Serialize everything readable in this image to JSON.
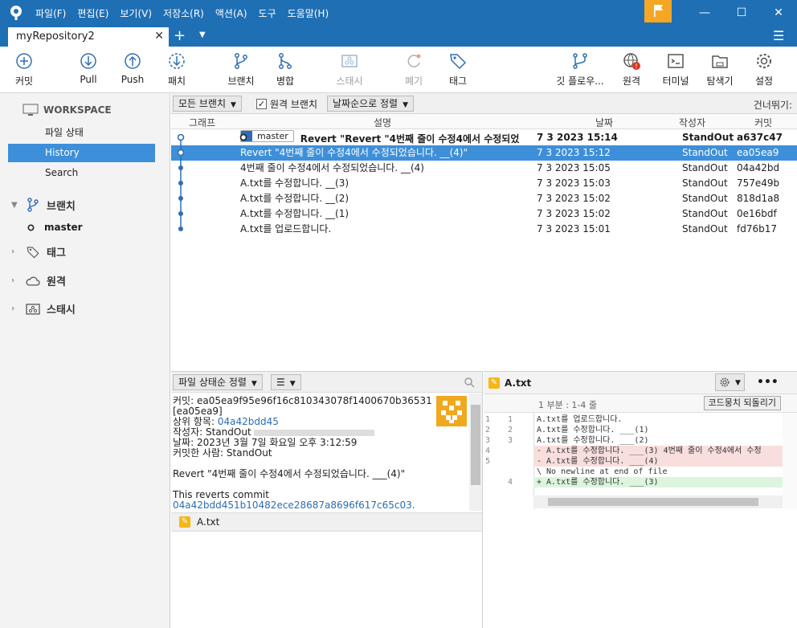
{
  "menu": [
    "파일(F)",
    "편집(E)",
    "보기(V)",
    "저장소(R)",
    "액션(A)",
    "도구",
    "도움말(H)"
  ],
  "window_controls": {
    "minimize": "—",
    "maximize": "☐",
    "close": "✕"
  },
  "tab": {
    "title": "myRepository2",
    "close": "✕",
    "add": "+"
  },
  "toolbar": {
    "commit": "커밋",
    "pull": "Pull",
    "push": "Push",
    "fetch": "패치",
    "branch": "브랜치",
    "merge": "병합",
    "stash": "스태시",
    "discard": "폐기",
    "tag": "태그",
    "gitflow": "깃 플로우...",
    "remote": "원격",
    "terminal": "터미널",
    "explorer": "탐색기",
    "settings": "설정"
  },
  "sidebar": {
    "workspace": "WORKSPACE",
    "items": [
      "파일 상태",
      "History",
      "Search"
    ],
    "branches_label": "브랜치",
    "branch_master": "master",
    "tags_label": "태그",
    "remotes_label": "원격",
    "stash_label": "스태시"
  },
  "filter": {
    "all_branches": "모든 브랜치",
    "remote_branches": "원격 브랜치",
    "sort_by_date": "날짜순으로 정렬",
    "skip": "건너뛰기:"
  },
  "columns": {
    "graph": "그래프",
    "desc": "설명",
    "date": "날짜",
    "author": "작성자",
    "commit": "커밋"
  },
  "commits": [
    {
      "branch": "master",
      "desc": "Revert \"Revert \"4번째 줄이 수정4에서 수정되었",
      "date": "7 3 2023 15:14",
      "author": "StandOut",
      "hash": "a637c47"
    },
    {
      "desc": "Revert \"4번째 줄이 수정4에서 수정되었습니다. __(4)\"",
      "date": "7 3 2023 15:12",
      "author": "StandOut",
      "hash": "ea05ea9"
    },
    {
      "desc": "4번째 줄이 수정4에서 수정되었습니다. __(4)",
      "date": "7 3 2023 15:05",
      "author": "StandOut",
      "hash": "04a42bd"
    },
    {
      "desc": "A.txt를 수정합니다. __(3)",
      "date": "7 3 2023 15:03",
      "author": "StandOut",
      "hash": "757e49b"
    },
    {
      "desc": "A.txt를 수정합니다. __(2)",
      "date": "7 3 2023 15:02",
      "author": "StandOut",
      "hash": "818d1a8"
    },
    {
      "desc": "A.txt를 수정합니다. __(1)",
      "date": "7 3 2023 15:02",
      "author": "StandOut",
      "hash": "0e16bdf"
    },
    {
      "desc": "A.txt를 업로드합니다.",
      "date": "7 3 2023 15:01",
      "author": "StandOut",
      "hash": "fd76b17"
    }
  ],
  "lower": {
    "sort_files": "파일 상태순 정렬",
    "list_icon": "☰",
    "details": {
      "commit_label": "커밋:",
      "commit_full": "ea05ea9f95e96f16c810343078f1400670b36531",
      "commit_short": "[ea05ea9]",
      "parent_label": "상위 항목:",
      "parent": "04a42bdd45",
      "author_label": "작성자:",
      "author": "StandOut",
      "date_label": "날짜:",
      "date": "2023년 3월 7일 화요일 오후 3:12:59",
      "committer_label": "커밋한 사람:",
      "committer": "StandOut",
      "message": "Revert \"4번째 줄이 수정4에서 수정되었습니다. ___(4)\"",
      "reverts": "This reverts commit",
      "reverts_hash": "04a42bdd451b10482ece28687a8696f617c65c03."
    },
    "file": "A.txt"
  },
  "diff": {
    "file": "A.txt",
    "hunk": "1 부분 : 1-4 줄",
    "hunk_button": "코드뭉치 되돌리기",
    "lines": [
      {
        "o": "1",
        "n": "1",
        "type": "ctx",
        "text": "  A.txt를 업로드합니다."
      },
      {
        "o": "2",
        "n": "2",
        "type": "ctx",
        "text": "  A.txt를 수정합니다. ___(1)"
      },
      {
        "o": "3",
        "n": "3",
        "type": "ctx",
        "text": "  A.txt를 수정합니다. ___(2)"
      },
      {
        "o": "4",
        "n": "",
        "type": "del",
        "text": "- A.txt를 수정합니다. ___(3) 4번째 줄이 수정4에서 수정"
      },
      {
        "o": "5",
        "n": "",
        "type": "del",
        "text": "- A.txt를 수정합니다. ___(4)"
      },
      {
        "o": "",
        "n": "",
        "type": "ctx",
        "text": "\\  No newline at end of file"
      },
      {
        "o": "",
        "n": "4",
        "type": "add",
        "text": "+ A.txt를 수정합니다. ___(3)"
      }
    ]
  },
  "colors": {
    "accent": "#3d8fd9",
    "titlebar": "#1f6fb5",
    "graph": "#2f6fb3"
  }
}
